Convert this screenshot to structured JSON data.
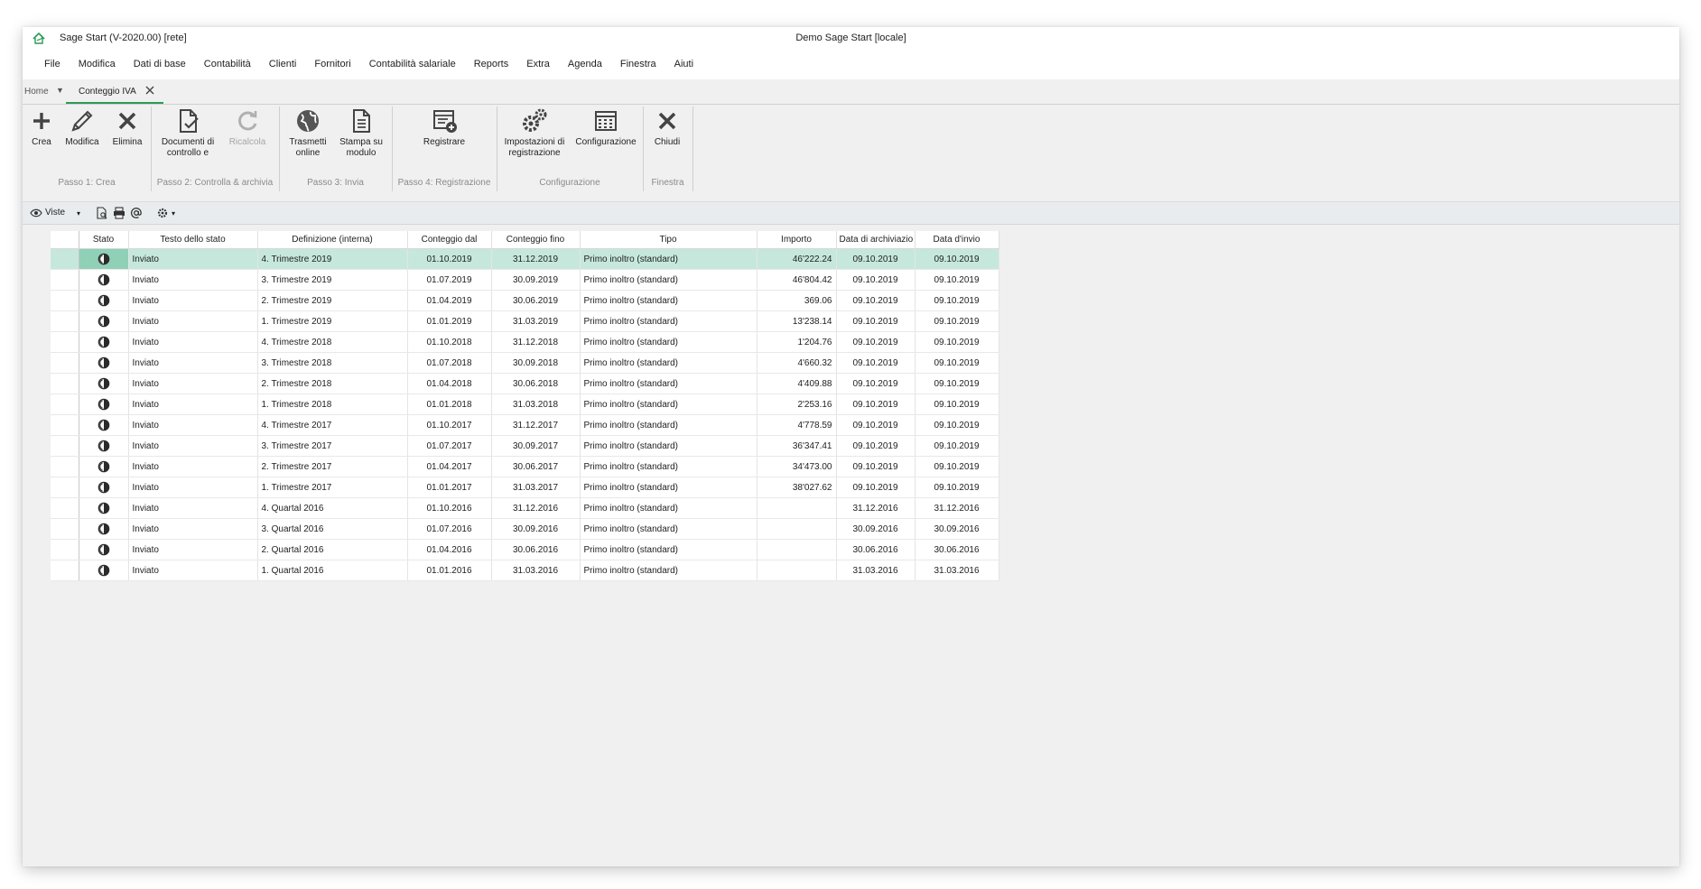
{
  "window": {
    "title_left": "Sage Start (V-2020.00) [rete]",
    "title_center": "Demo Sage Start [locale]"
  },
  "menu": [
    "File",
    "Modifica",
    "Dati di base",
    "Contabilità",
    "Clienti",
    "Fornitori",
    "Contabilità salariale",
    "Reports",
    "Extra",
    "Agenda",
    "Finestra",
    "Aiuti"
  ],
  "tabs": {
    "home": "Home",
    "active": "Conteggio IVA"
  },
  "ribbon": {
    "groups": {
      "g1": "Passo 1: Crea",
      "g2": "Passo 2: Controlla & archivia",
      "g3": "Passo 3: Invia",
      "g4": "Passo 4: Registrazione",
      "g5": "Configurazione",
      "g6": "Finestra"
    },
    "buttons": {
      "crea": "Crea",
      "modifica": "Modifica",
      "elimina": "Elimina",
      "documenti": "Documenti di controllo e",
      "ricalcola": "Ricalcola",
      "trasmetti": "Trasmetti online",
      "stampa": "Stampa su modulo",
      "registrare": "Registrare",
      "impostazioni": "Impostazioni di registrazione",
      "configurazione": "Configurazione",
      "chiudi": "Chiudi"
    }
  },
  "viewbar": {
    "viste": "Viste"
  },
  "grid": {
    "columns": [
      "Stato",
      "Testo dello stato",
      "Definizione (interna)",
      "Conteggio dal",
      "Conteggio fino",
      "Tipo",
      "Importo",
      "Data di archiviazio",
      "Data d'invio"
    ],
    "rows": [
      {
        "testo": "Inviato",
        "def": "4. Trimestre 2019",
        "dal": "01.10.2019",
        "fino": "31.12.2019",
        "tipo": "Primo inoltro (standard)",
        "importo": "46'222.24",
        "arch": "09.10.2019",
        "invio": "09.10.2019"
      },
      {
        "testo": "Inviato",
        "def": "3. Trimestre 2019",
        "dal": "01.07.2019",
        "fino": "30.09.2019",
        "tipo": "Primo inoltro (standard)",
        "importo": "46'804.42",
        "arch": "09.10.2019",
        "invio": "09.10.2019"
      },
      {
        "testo": "Inviato",
        "def": "2. Trimestre 2019",
        "dal": "01.04.2019",
        "fino": "30.06.2019",
        "tipo": "Primo inoltro (standard)",
        "importo": "369.06",
        "arch": "09.10.2019",
        "invio": "09.10.2019"
      },
      {
        "testo": "Inviato",
        "def": "1. Trimestre 2019",
        "dal": "01.01.2019",
        "fino": "31.03.2019",
        "tipo": "Primo inoltro (standard)",
        "importo": "13'238.14",
        "arch": "09.10.2019",
        "invio": "09.10.2019"
      },
      {
        "testo": "Inviato",
        "def": "4. Trimestre 2018",
        "dal": "01.10.2018",
        "fino": "31.12.2018",
        "tipo": "Primo inoltro (standard)",
        "importo": "1'204.76",
        "arch": "09.10.2019",
        "invio": "09.10.2019"
      },
      {
        "testo": "Inviato",
        "def": "3. Trimestre 2018",
        "dal": "01.07.2018",
        "fino": "30.09.2018",
        "tipo": "Primo inoltro (standard)",
        "importo": "4'660.32",
        "arch": "09.10.2019",
        "invio": "09.10.2019"
      },
      {
        "testo": "Inviato",
        "def": "2. Trimestre 2018",
        "dal": "01.04.2018",
        "fino": "30.06.2018",
        "tipo": "Primo inoltro (standard)",
        "importo": "4'409.88",
        "arch": "09.10.2019",
        "invio": "09.10.2019"
      },
      {
        "testo": "Inviato",
        "def": "1. Trimestre 2018",
        "dal": "01.01.2018",
        "fino": "31.03.2018",
        "tipo": "Primo inoltro (standard)",
        "importo": "2'253.16",
        "arch": "09.10.2019",
        "invio": "09.10.2019"
      },
      {
        "testo": "Inviato",
        "def": "4. Trimestre 2017",
        "dal": "01.10.2017",
        "fino": "31.12.2017",
        "tipo": "Primo inoltro (standard)",
        "importo": "4'778.59",
        "arch": "09.10.2019",
        "invio": "09.10.2019"
      },
      {
        "testo": "Inviato",
        "def": "3. Trimestre 2017",
        "dal": "01.07.2017",
        "fino": "30.09.2017",
        "tipo": "Primo inoltro (standard)",
        "importo": "36'347.41",
        "arch": "09.10.2019",
        "invio": "09.10.2019"
      },
      {
        "testo": "Inviato",
        "def": "2. Trimestre 2017",
        "dal": "01.04.2017",
        "fino": "30.06.2017",
        "tipo": "Primo inoltro (standard)",
        "importo": "34'473.00",
        "arch": "09.10.2019",
        "invio": "09.10.2019"
      },
      {
        "testo": "Inviato",
        "def": "1. Trimestre 2017",
        "dal": "01.01.2017",
        "fino": "31.03.2017",
        "tipo": "Primo inoltro (standard)",
        "importo": "38'027.62",
        "arch": "09.10.2019",
        "invio": "09.10.2019"
      },
      {
        "testo": "Inviato",
        "def": "4. Quartal 2016",
        "dal": "01.10.2016",
        "fino": "31.12.2016",
        "tipo": "Primo inoltro (standard)",
        "importo": "",
        "arch": "31.12.2016",
        "invio": "31.12.2016"
      },
      {
        "testo": "Inviato",
        "def": "3. Quartal 2016",
        "dal": "01.07.2016",
        "fino": "30.09.2016",
        "tipo": "Primo inoltro (standard)",
        "importo": "",
        "arch": "30.09.2016",
        "invio": "30.09.2016"
      },
      {
        "testo": "Inviato",
        "def": "2. Quartal 2016",
        "dal": "01.04.2016",
        "fino": "30.06.2016",
        "tipo": "Primo inoltro (standard)",
        "importo": "",
        "arch": "30.06.2016",
        "invio": "30.06.2016"
      },
      {
        "testo": "Inviato",
        "def": "1. Quartal 2016",
        "dal": "01.01.2016",
        "fino": "31.03.2016",
        "tipo": "Primo inoltro (standard)",
        "importo": "",
        "arch": "31.03.2016",
        "invio": "31.03.2016"
      }
    ]
  },
  "colors": {
    "accent": "#2d9b56",
    "selected_row": "#c6e8dc"
  }
}
